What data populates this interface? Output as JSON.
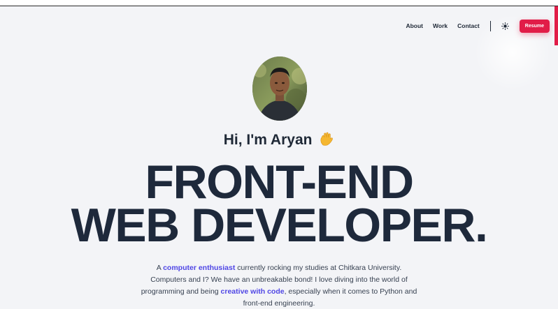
{
  "nav": {
    "links": [
      "About",
      "Work",
      "Contact"
    ],
    "theme_icon": "sun-icon",
    "resume_label": "Resume"
  },
  "hero": {
    "avatar_icon": "profile-photo",
    "greeting": "Hi, I'm Aryan",
    "greeting_emoji": "waving-hand-icon",
    "headline_line1": "FRONT-END",
    "headline_line2": "WEB DEVELOPER.",
    "bio": {
      "p1": "A ",
      "hl1": "computer enthusiast",
      "p2": " currently rocking my studies at Chitkara University. Computers and I? We have an unbreakable bond! I love diving into the world of programming and being ",
      "hl2": "creative with code",
      "p3": ", especially when it comes to Python and front-end engineering."
    }
  },
  "colors": {
    "accent": "#e11d48",
    "highlight": "#4f46e5",
    "headline": "#1e293b",
    "background": "#f3f4f7"
  }
}
